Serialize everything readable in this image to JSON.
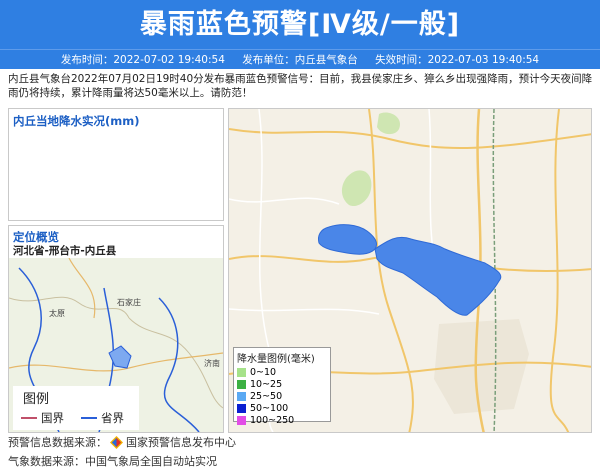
{
  "header": {
    "title": "暴雨蓝色预警[Ⅳ级/一般]",
    "publish_time": "发布时间：2022-07-02 19:40:54",
    "publisher": "发布单位：内丘县气象台",
    "expire_time": "失效时间：2022-07-03 19:40:54"
  },
  "description": "内丘县气象台2022年07月02日19时40分发布暴雨蓝色预警信号：目前，我县侯家庄乡、獐么乡出现强降雨，预计今天夜间降雨仍将持续，累计降雨量将达50毫米以上。请防范！",
  "rain_panel": {
    "title": "内丘当地降水实况(mm)"
  },
  "location_panel": {
    "title": "定位概览",
    "path": "河北省-邢台市-内丘县",
    "cities": [
      "石家庄",
      "太原",
      "济南"
    ],
    "legend_title": "图例",
    "legend_items": [
      {
        "label": "国界",
        "color": "#c0506a"
      },
      {
        "label": "省界",
        "color": "#2a5fd8"
      }
    ]
  },
  "rain_legend": {
    "title": "降水量图例(毫米)",
    "items": [
      {
        "label": "0~10",
        "color": "#a6e28a"
      },
      {
        "label": "10~25",
        "color": "#3cb043"
      },
      {
        "label": "25~50",
        "color": "#5aa9f3"
      },
      {
        "label": "50~100",
        "color": "#0a1fd1"
      },
      {
        "label": "100~250",
        "color": "#e24ce6"
      }
    ]
  },
  "footer": {
    "warning_source": "预警信息数据来源：",
    "warning_source_name": "国家预警信息发布中心",
    "weather_source": "气象数据来源：中国气象局全国自动站实况"
  }
}
